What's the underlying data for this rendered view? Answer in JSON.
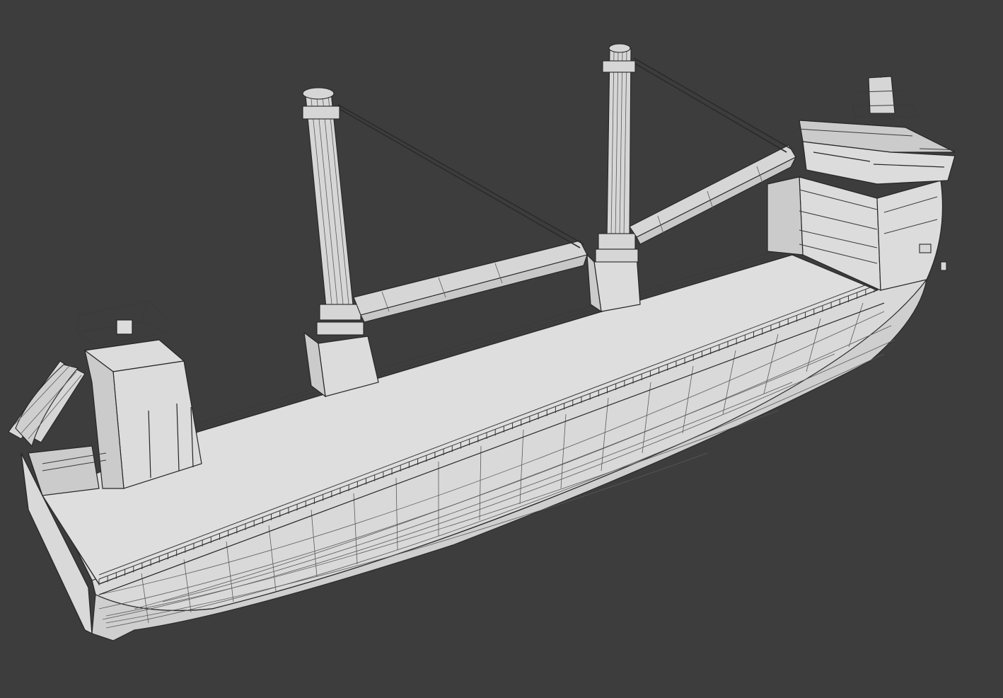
{
  "viewport": {
    "background": "#3d3d3d",
    "model_fill": "#d9d9d9",
    "wire_color": "#2a2a2a"
  },
  "scene": {
    "model": "cargo-ship-wireframe",
    "parts": [
      "hull",
      "main-deck",
      "bow-superstructure",
      "stern-bridge",
      "crane-forward",
      "crane-aft",
      "stern-ramp"
    ]
  }
}
